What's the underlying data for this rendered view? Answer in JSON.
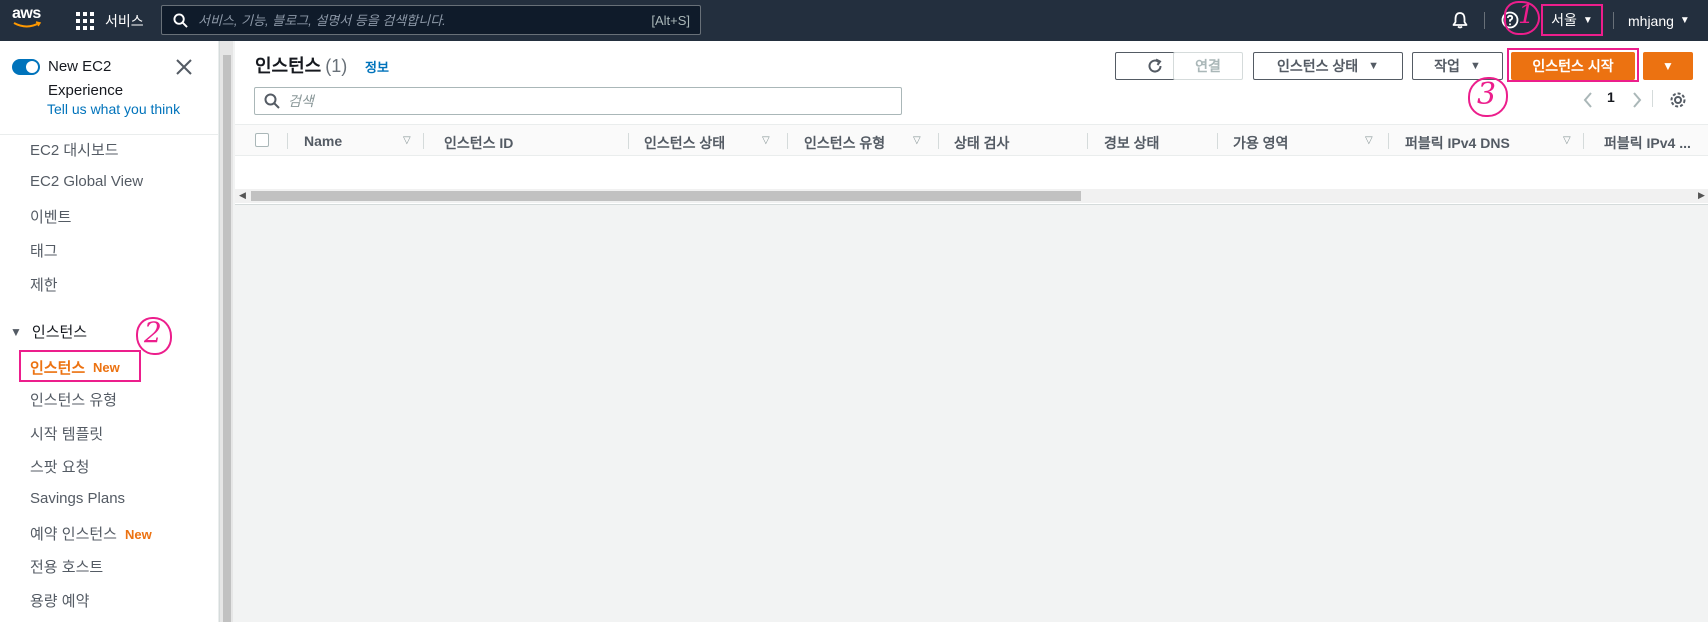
{
  "topnav": {
    "logo": "aws",
    "services_label": "서비스",
    "search_placeholder": "서비스, 기능, 블로그, 설명서 등을 검색합니다.",
    "search_shortcut": "[Alt+S]",
    "region": "서울",
    "user": "mhjang",
    "bg_color": "#232f3e"
  },
  "sidebar": {
    "experience_title": "New EC2 Experience",
    "feedback_link": "Tell us what you think",
    "items_top": [
      "EC2 대시보드",
      "EC2 Global View",
      "이벤트",
      "태그",
      "제한"
    ],
    "section": "인스턴스",
    "active_item": "인스턴스",
    "new_badge": "New",
    "items_instances": [
      "인스턴스 유형",
      "시작 템플릿",
      "스팟 요청",
      "Savings Plans"
    ],
    "reserved_item": "예약 인스턴스",
    "items_bottom": [
      "전용 호스트",
      "용량 예약"
    ]
  },
  "main": {
    "title": "인스턴스",
    "count": "(1)",
    "info": "정보",
    "connect_button": "연결",
    "state_button": "인스턴스 상태",
    "actions_button": "작업",
    "launch_button": "인스턴스 시작",
    "filter_placeholder": "검색",
    "page_number": "1",
    "columns": [
      "Name",
      "인스턴스 ID",
      "인스턴스 상태",
      "인스턴스 유형",
      "상태 검사",
      "경보 상태",
      "가용 영역",
      "퍼블릭 IPv4 DNS",
      "퍼블릭 IPv4 ..."
    ],
    "accent_color": "#ec7211",
    "highlight_color": "#ec1e8c"
  },
  "annotations": [
    "1",
    "2",
    "3"
  ]
}
